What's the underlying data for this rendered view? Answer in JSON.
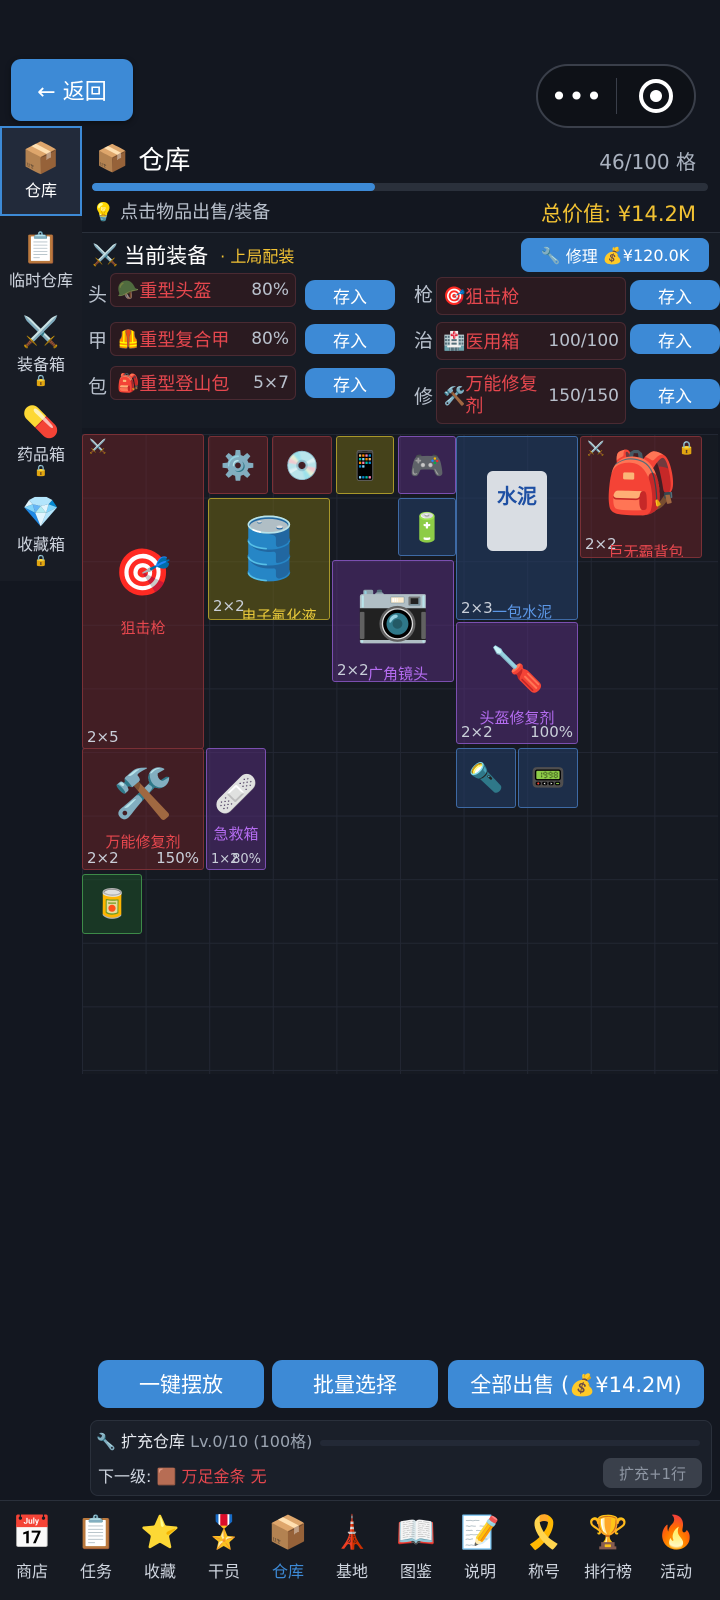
{
  "header": {
    "back_label": "← 返回",
    "menu_dots": "•••",
    "title": "仓库",
    "capacity": "46/100 格",
    "capacity_fraction": 0.46,
    "hint": "点击物品出售/装备",
    "total_value": "总价值: ¥14.2M"
  },
  "sidebar": {
    "items": [
      {
        "label": "仓库",
        "icon": "box-icon",
        "locked": false
      },
      {
        "label": "临时仓库",
        "icon": "clipboard-icon",
        "locked": false
      },
      {
        "label": "装备箱",
        "icon": "crossed-swords-icon",
        "locked": true
      },
      {
        "label": "药品箱",
        "icon": "pill-icon",
        "locked": true
      },
      {
        "label": "收藏箱",
        "icon": "gem-icon",
        "locked": true
      }
    ]
  },
  "equipment": {
    "title": "当前装备",
    "subtitle": "· 上局配装",
    "repair_label": "修理",
    "repair_cost": "¥120.0K",
    "store_label": "存入",
    "slots": [
      {
        "tag": "头",
        "name": "重型头盔",
        "value": "80%"
      },
      {
        "tag": "甲",
        "name": "重型复合甲",
        "value": "80%"
      },
      {
        "tag": "包",
        "name": "重型登山包",
        "value": "5×7"
      },
      {
        "tag": "枪",
        "name": "狙击枪",
        "value": ""
      },
      {
        "tag": "治",
        "name": "医用箱",
        "value": "100/100"
      },
      {
        "tag": "修",
        "name": "万能修复剂",
        "value": "150/150"
      }
    ]
  },
  "grid_items": {
    "sniper": {
      "name": "狙击枪",
      "size": "2×5"
    },
    "coolant": {
      "name": "电子氟化液",
      "size": "2×2"
    },
    "lens": {
      "name": "广角镜头",
      "size": "2×2"
    },
    "cement": {
      "name": "一包水泥",
      "size": "2×3",
      "bag_text": "水泥"
    },
    "backpack": {
      "name": "巨无霸背包",
      "size": "2×2"
    },
    "helmet_repair": {
      "name": "头盔修复剂",
      "size": "2×2",
      "value": "100%"
    },
    "repair_kit": {
      "name": "万能修复剂",
      "size": "2×2",
      "value": "150%"
    },
    "first_aid": {
      "name": "急救箱",
      "size": "1×2",
      "value": "80%"
    }
  },
  "actions": {
    "auto_place": "一键摆放",
    "batch_select": "批量选择",
    "sell_all": "全部出售 (💰¥14.2M)"
  },
  "expand": {
    "title": "扩充仓库",
    "level": "Lv.0/10 (100格)",
    "next_label": "下一级:",
    "next_item": "万足金条",
    "next_status": "无",
    "button": "扩充+1行"
  },
  "nav": [
    {
      "label": "商店",
      "icon": "calendar-24-icon"
    },
    {
      "label": "任务",
      "icon": "clipboard-icon"
    },
    {
      "label": "收藏",
      "icon": "star-icon"
    },
    {
      "label": "干员",
      "icon": "medal-icon"
    },
    {
      "label": "仓库",
      "icon": "box-icon",
      "active": true
    },
    {
      "label": "基地",
      "icon": "tower-icon"
    },
    {
      "label": "图鉴",
      "icon": "book-icon"
    },
    {
      "label": "说明",
      "icon": "memo-icon"
    },
    {
      "label": "称号",
      "icon": "ribbon-icon"
    },
    {
      "label": "排行榜",
      "icon": "trophy-icon"
    },
    {
      "label": "活动",
      "icon": "fire-icon"
    }
  ],
  "colors": {
    "accent": "#3d8ad6",
    "gold": "#f2c233",
    "danger": "#e6474e",
    "purple": "#b46cf0",
    "blue_item": "#5c97e6"
  }
}
